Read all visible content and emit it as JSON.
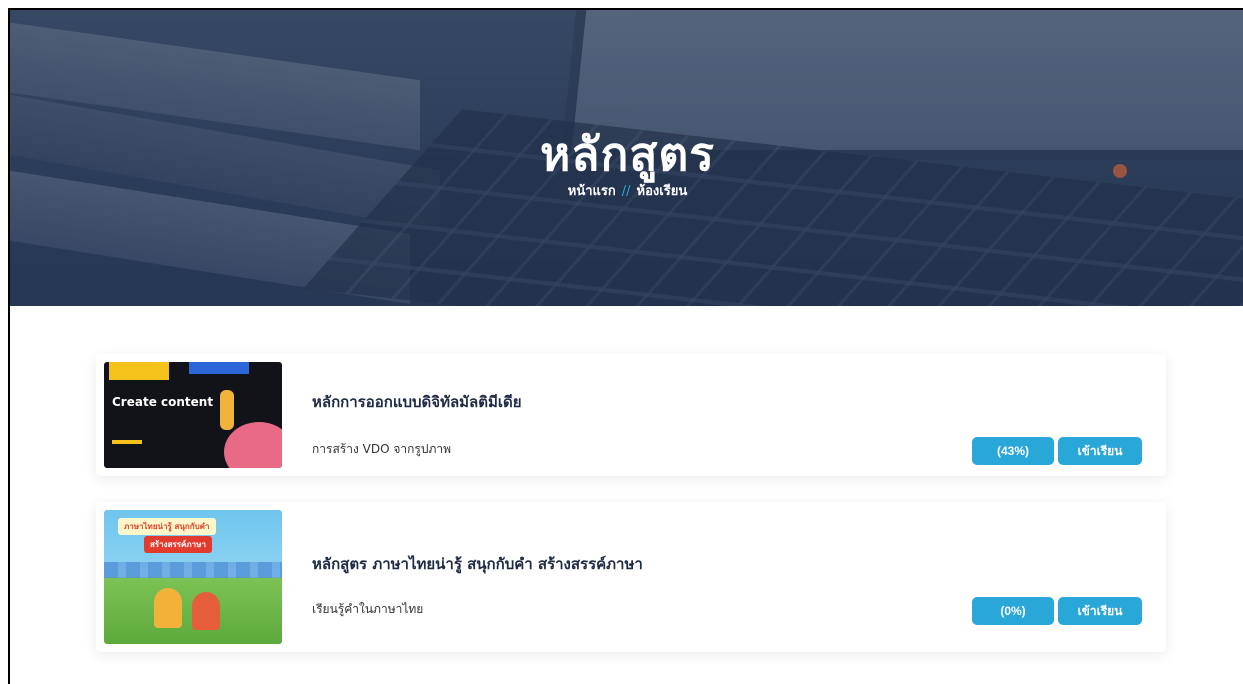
{
  "hero": {
    "title": "หลักสูตร",
    "breadcrumb": {
      "home": "หน้าแรก",
      "separator": "//",
      "current": "ห้องเรียน"
    }
  },
  "courses": [
    {
      "title": "หลักการออกแบบดิจิทัลมัลติมีเดีย",
      "subtitle": "การสร้าง VDO จากรูปภาพ",
      "progress_label": "(43%)",
      "progress": 43,
      "enter_label": "เข้าเรียน",
      "thumbnail_text": "Create content"
    },
    {
      "title": "หลักสูตร ภาษาไทยน่ารู้ สนุกกับคำ สร้างสรรค์ภาษา",
      "subtitle": "เรียนรู้คำในภาษาไทย",
      "progress_label": "(0%)",
      "progress": 0,
      "enter_label": "เข้าเรียน",
      "thumbnail_text_1": "ภาษาไทยน่ารู้ สนุกกับคำ",
      "thumbnail_text_2": "สร้างสรรค์ภาษา"
    }
  ],
  "colors": {
    "accent": "#2aa7d9",
    "title_text": "#1f2a44",
    "hero_overlay": "#283a5a"
  }
}
